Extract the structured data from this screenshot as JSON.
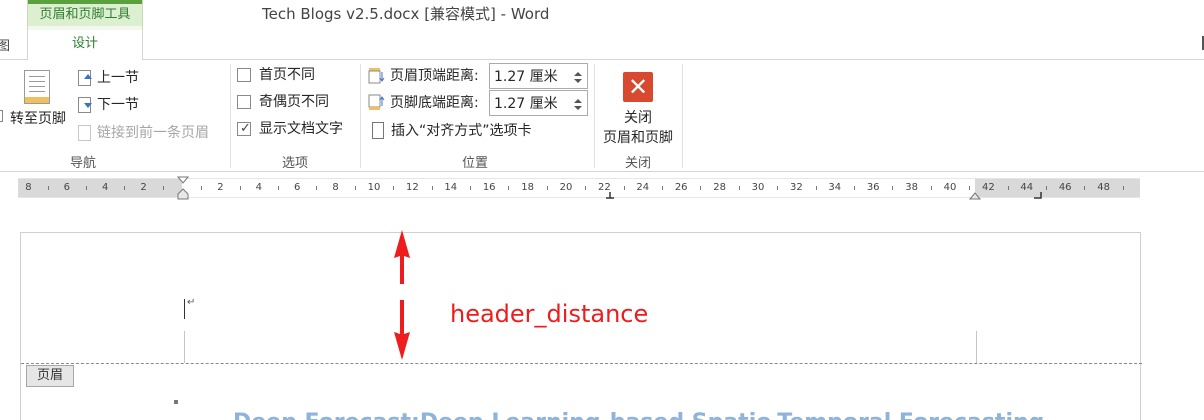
{
  "window": {
    "context_group": "页眉和页脚工具",
    "document_title": "Tech Blogs v2.5.docx [兼容模式] - Word"
  },
  "tabs": {
    "left_partial": "图",
    "design": "设计"
  },
  "ribbon": {
    "navigation": {
      "goto_footer": "转至页脚",
      "previous_section": "上一节",
      "next_section": "下一节",
      "link_to_previous": "链接到前一条页眉",
      "label": "导航"
    },
    "options": {
      "different_first_page": {
        "label": "首页不同",
        "checked": false
      },
      "different_odd_even": {
        "label": "奇偶页不同",
        "checked": false
      },
      "show_document_text": {
        "label": "显示文档文字",
        "checked": true
      },
      "label": "选项"
    },
    "position": {
      "header_from_top_label": "页眉顶端距离:",
      "header_from_top_value": "1.27 厘米",
      "footer_from_bottom_label": "页脚底端距离:",
      "footer_from_bottom_value": "1.27 厘米",
      "insert_alignment_tab": "插入“对齐方式”选项卡",
      "label": "位置"
    },
    "close": {
      "button_line1": "关闭",
      "button_line2": "页眉和页脚",
      "label": "关闭"
    }
  },
  "ruler": {
    "left_numbers": [
      "8",
      "6",
      "4",
      "2"
    ],
    "right_numbers": [
      "2",
      "4",
      "6",
      "8",
      "10",
      "12",
      "14",
      "16",
      "18",
      "20",
      "22",
      "24",
      "26",
      "28",
      "30",
      "32",
      "34",
      "36",
      "38",
      "40",
      "42",
      "44",
      "46",
      "48"
    ]
  },
  "document": {
    "header_tag": "页眉",
    "annotation": "header_distance",
    "partial_title": "Deep Forecast:Deep Learning-based Spatio-Temporal Forecasting"
  },
  "colors": {
    "context_green": "#2e7d32",
    "close_red": "#d84a2f",
    "annotation_red": "#ee1c1c",
    "title_blue": "#8fb3d9"
  }
}
